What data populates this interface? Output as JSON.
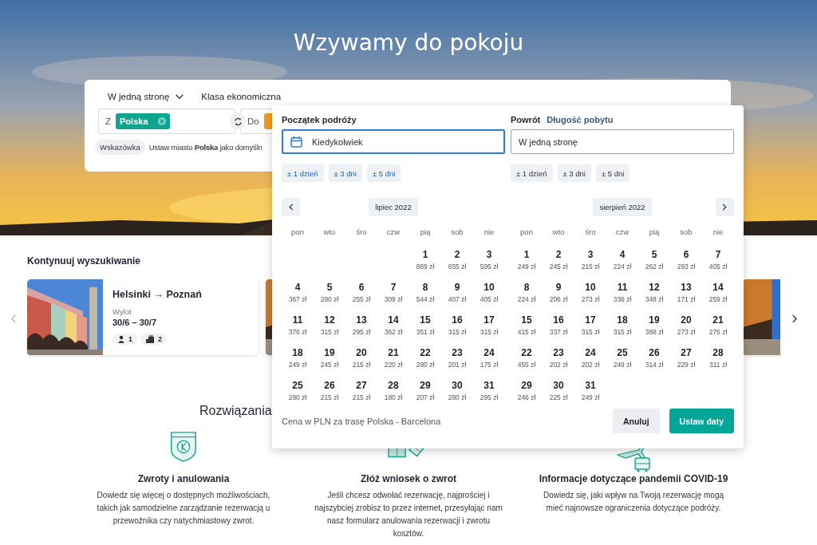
{
  "hero": {
    "title": "Wzywamy do pokoju"
  },
  "search": {
    "trip_type": "W jedną stronę",
    "cabin_class": "Klasa ekonomiczna",
    "from": {
      "prefix": "Z",
      "chip": "Polska"
    },
    "to": {
      "prefix": "Do"
    },
    "hint": {
      "badge": "Wskazówka",
      "text": "Ustaw miasto **Polska** jako domyśln"
    }
  },
  "recent": {
    "title": "Kontynuuj wyszukiwanie",
    "cards": [
      {
        "kind": "full",
        "route": "Helsinki → Poznań",
        "label": "Wylot",
        "dates": "30/6 – 30/7",
        "passengers": "1",
        "bags": "2"
      },
      {
        "kind": "peek"
      },
      {
        "kind": "spacer"
      },
      {
        "kind": "peek"
      }
    ]
  },
  "help": {
    "title": "Rozwiązania",
    "items": [
      {
        "kind": "shield",
        "title": "Zwroty i anulowania",
        "text": "Dowiedz się więcej o dostępnych możliwościach, takich jak samodzielne zarządzanie rezerwacją u przewoźnika czy natychmiastowy zwrot."
      },
      {
        "kind": "tickets",
        "title": "Złóż wniosek o zwrot",
        "text": "Jeśli chcesz odwołać rezerwację, najprościej i najszybciej zrobisz to przez internet, przesyłając nam nasz formularz anulowania rezerwacji i zwrotu kosztów."
      },
      {
        "kind": "travel",
        "title": "Informacje dotyczące pandemii COVID-19",
        "text": "Dowiedz się, jaki wpływ na Twoją rezerwację mogą mieć najnowsze ograniczenia dotyczące podróży."
      }
    ]
  },
  "datepicker": {
    "departure": {
      "label": "Początek podróży",
      "value": "Kiedykolwiek",
      "focused": true,
      "flex": [
        "± 1 dzień",
        "± 3 dni",
        "± 5 dni"
      ]
    },
    "return": {
      "label": "Powrót",
      "link": "Długość pobytu",
      "value": "W jedną stronę",
      "focused": false,
      "flex": [
        "± 1 dzień",
        "± 3 dni",
        "± 5 dni"
      ]
    },
    "months": [
      {
        "label": "lipiec 2022",
        "weekdays": [
          "pon",
          "wto",
          "śro",
          "czw",
          "pią",
          "sob",
          "nie"
        ],
        "weeks": [
          [
            {
              "kind": "blank"
            },
            {
              "kind": "blank"
            },
            {
              "kind": "blank"
            },
            {
              "kind": "blank"
            },
            {
              "kind": "day",
              "day": "1",
              "price": "869 zł"
            },
            {
              "kind": "day",
              "day": "2",
              "price": "655 zł"
            },
            {
              "kind": "day",
              "day": "3",
              "price": "595 zł"
            }
          ],
          [
            {
              "kind": "day",
              "day": "4",
              "price": "367 zł"
            },
            {
              "kind": "day",
              "day": "5",
              "price": "280 zł"
            },
            {
              "kind": "day",
              "day": "6",
              "price": "255 zł"
            },
            {
              "kind": "day",
              "day": "7",
              "price": "309 zł"
            },
            {
              "kind": "day",
              "day": "8",
              "price": "544 zł"
            },
            {
              "kind": "day",
              "day": "9",
              "price": "407 zł"
            },
            {
              "kind": "day",
              "day": "10",
              "price": "405 zł"
            }
          ],
          [
            {
              "kind": "day",
              "day": "11",
              "price": "376 zł"
            },
            {
              "kind": "day",
              "day": "12",
              "price": "315 zł"
            },
            {
              "kind": "day",
              "day": "13",
              "price": "295 zł"
            },
            {
              "kind": "day",
              "day": "14",
              "price": "362 zł"
            },
            {
              "kind": "day",
              "day": "15",
              "price": "351 zł"
            },
            {
              "kind": "day",
              "day": "16",
              "price": "315 zł"
            },
            {
              "kind": "day",
              "day": "17",
              "price": "315 zł"
            }
          ],
          [
            {
              "kind": "day",
              "day": "18",
              "price": "249 zł"
            },
            {
              "kind": "day",
              "day": "19",
              "price": "245 zł"
            },
            {
              "kind": "day",
              "day": "20",
              "price": "215 zł"
            },
            {
              "kind": "day",
              "day": "21",
              "price": "220 zł"
            },
            {
              "kind": "day",
              "day": "22",
              "price": "280 zł"
            },
            {
              "kind": "day",
              "day": "23",
              "price": "201 zł"
            },
            {
              "kind": "day",
              "day": "24",
              "price": "175 zł"
            }
          ],
          [
            {
              "kind": "day",
              "day": "25",
              "price": "280 zł"
            },
            {
              "kind": "day",
              "day": "26",
              "price": "215 zł"
            },
            {
              "kind": "day",
              "day": "27",
              "price": "215 zł"
            },
            {
              "kind": "day",
              "day": "28",
              "price": "180 zł"
            },
            {
              "kind": "day",
              "day": "29",
              "price": "207 zł"
            },
            {
              "kind": "day",
              "day": "30",
              "price": "280 zł"
            },
            {
              "kind": "day",
              "day": "31",
              "price": "295 zł"
            }
          ]
        ]
      },
      {
        "label": "sierpień 2022",
        "weekdays": [
          "pon",
          "wto",
          "śro",
          "czw",
          "pią",
          "sob",
          "nie"
        ],
        "weeks": [
          [
            {
              "kind": "day",
              "day": "1",
              "price": "249 zł"
            },
            {
              "kind": "day",
              "day": "2",
              "price": "245 zł"
            },
            {
              "kind": "day",
              "day": "3",
              "price": "215 zł"
            },
            {
              "kind": "day",
              "day": "4",
              "price": "224 zł"
            },
            {
              "kind": "day",
              "day": "5",
              "price": "262 zł"
            },
            {
              "kind": "day",
              "day": "6",
              "price": "293 zł"
            },
            {
              "kind": "day",
              "day": "7",
              "price": "405 zł"
            }
          ],
          [
            {
              "kind": "day",
              "day": "8",
              "price": "224 zł"
            },
            {
              "kind": "day",
              "day": "9",
              "price": "206 zł"
            },
            {
              "kind": "day",
              "day": "10",
              "price": "273 zł"
            },
            {
              "kind": "day",
              "day": "11",
              "price": "336 zł"
            },
            {
              "kind": "day",
              "day": "12",
              "price": "348 zł"
            },
            {
              "kind": "day",
              "day": "13",
              "price": "171 zł"
            },
            {
              "kind": "day",
              "day": "14",
              "price": "259 zł"
            }
          ],
          [
            {
              "kind": "day",
              "day": "15",
              "price": "415 zł"
            },
            {
              "kind": "day",
              "day": "16",
              "price": "337 zł"
            },
            {
              "kind": "day",
              "day": "17",
              "price": "315 zł"
            },
            {
              "kind": "day",
              "day": "18",
              "price": "315 zł"
            },
            {
              "kind": "day",
              "day": "19",
              "price": "388 zł"
            },
            {
              "kind": "day",
              "day": "20",
              "price": "273 zł"
            },
            {
              "kind": "day",
              "day": "21",
              "price": "276 zł"
            }
          ],
          [
            {
              "kind": "day",
              "day": "22",
              "price": "455 zł"
            },
            {
              "kind": "day",
              "day": "23",
              "price": "202 zł"
            },
            {
              "kind": "day",
              "day": "24",
              "price": "202 zł"
            },
            {
              "kind": "day",
              "day": "25",
              "price": "249 zł"
            },
            {
              "kind": "day",
              "day": "26",
              "price": "314 zł"
            },
            {
              "kind": "day",
              "day": "27",
              "price": "229 zł"
            },
            {
              "kind": "day",
              "day": "28",
              "price": "311 zł"
            }
          ],
          [
            {
              "kind": "day",
              "day": "29",
              "price": "246 zł"
            },
            {
              "kind": "day",
              "day": "30",
              "price": "225 zł"
            },
            {
              "kind": "day",
              "day": "31",
              "price": "249 zł"
            }
          ]
        ]
      }
    ],
    "note": "Cena w PLN za trasę Polska - Barcelona",
    "buttons": [
      {
        "label": "Anuluj",
        "kind": "secondary"
      },
      {
        "label": "Ustaw daty",
        "kind": "primary"
      }
    ]
  }
}
